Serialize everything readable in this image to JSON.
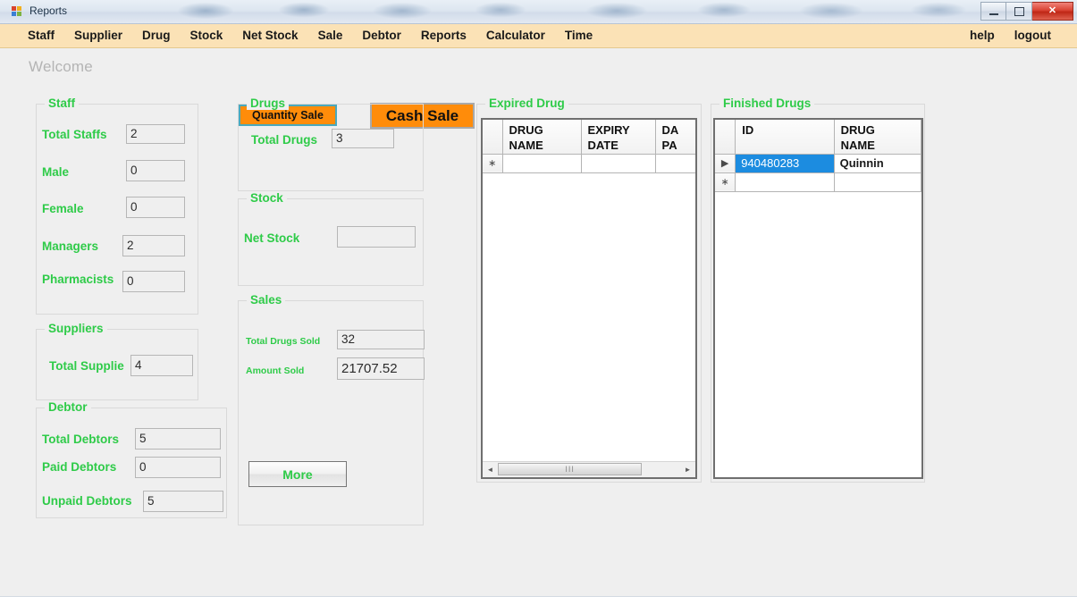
{
  "window": {
    "title": "Reports",
    "icon": "app-logo-icon",
    "controls": {
      "minimize": "–",
      "maximize": "□",
      "close": "✕"
    }
  },
  "menubar": {
    "left_items": [
      "Staff",
      "Supplier",
      "Drug",
      "Stock",
      "Net Stock",
      "Sale",
      "Debtor",
      "Reports",
      "Calculator",
      "Time"
    ],
    "right_items": [
      "help",
      "logout"
    ]
  },
  "header": {
    "welcome": "Welcome",
    "quantity_sale": "Quantity Sale",
    "cash_sale": "Cash Sale"
  },
  "staff": {
    "title": "Staff",
    "fields": [
      {
        "label": "Total Staffs",
        "value": "2"
      },
      {
        "label": "Male",
        "value": "0"
      },
      {
        "label": "Female",
        "value": "0"
      },
      {
        "label": "Managers",
        "value": "2"
      },
      {
        "label": "Pharmacists",
        "value": "0"
      }
    ]
  },
  "suppliers": {
    "title": "Suppliers",
    "fields": [
      {
        "label": "Total Supplie",
        "value": "4"
      }
    ]
  },
  "debtor": {
    "title": "Debtor",
    "fields": [
      {
        "label": "Total Debtors",
        "value": "5"
      },
      {
        "label": "Paid Debtors",
        "value": "0"
      },
      {
        "label": "Unpaid Debtors",
        "value": "5"
      }
    ]
  },
  "drugs": {
    "title": "Drugs",
    "fields": [
      {
        "label": "Total Drugs",
        "value": "3"
      }
    ]
  },
  "stock": {
    "title": "Stock",
    "fields": [
      {
        "label": "Net Stock",
        "value": ""
      }
    ]
  },
  "sales": {
    "title": "Sales",
    "fields": [
      {
        "label": "Total Drugs Sold",
        "value": "32"
      },
      {
        "label": "Amount Sold",
        "value": "21707.52"
      }
    ],
    "more_button": "More"
  },
  "expired_drug": {
    "title": "Expired Drug",
    "columns": [
      "DRUG\nNAME",
      "EXPIRY\nDATE",
      "DA\nPA"
    ],
    "rows": [
      {
        "marker": "∗",
        "cells": [
          "",
          "",
          ""
        ]
      }
    ],
    "scrollbar": {
      "left_arrow": "◄",
      "right_arrow": "►",
      "grip": "III"
    }
  },
  "finished_drugs": {
    "title": "Finished Drugs",
    "columns": [
      "ID",
      "DRUG\nNAME"
    ],
    "rows": [
      {
        "marker": "▶",
        "cells": [
          "940480283",
          "Quinnin"
        ],
        "selected": true
      },
      {
        "marker": "∗",
        "cells": [
          "",
          ""
        ],
        "selected": false
      }
    ]
  },
  "colors": {
    "menubar_bg": "#fbe2b6",
    "accent_green": "#2ecb48",
    "orange_button": "#ff8c0a",
    "selection_blue": "#1c8ce0",
    "client_bg": "#efefef",
    "focus_border": "#4aa8bc"
  }
}
